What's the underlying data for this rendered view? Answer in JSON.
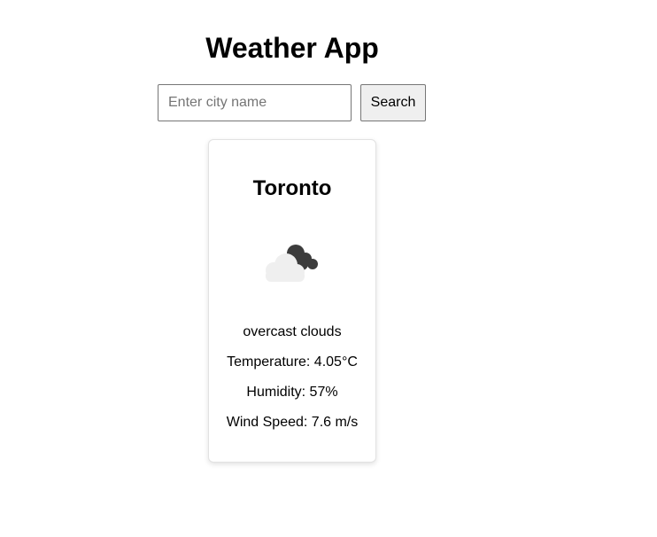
{
  "header": {
    "title": "Weather App"
  },
  "search": {
    "placeholder": "Enter city name",
    "value": "",
    "button_label": "Search"
  },
  "weather": {
    "city": "Toronto",
    "icon": "overcast-clouds-icon",
    "description": "overcast clouds",
    "temperature": "Temperature: 4.05°C",
    "humidity": "Humidity: 57%",
    "wind_speed": "Wind Speed: 7.6 m/s"
  },
  "colors": {
    "cloud_light": "#efefef",
    "cloud_dark": "#3c3c3c",
    "button_bg": "#efefef"
  }
}
